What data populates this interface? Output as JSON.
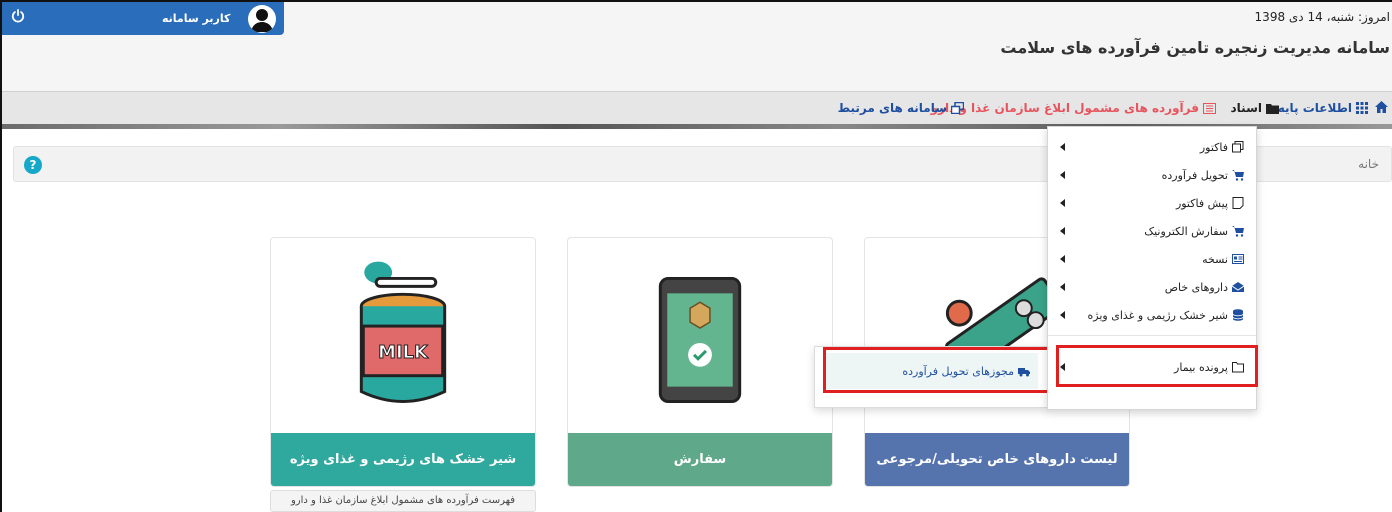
{
  "header": {
    "user_label": "کاربر سامانه",
    "date_text": "امروز: شنبه، 14 دی 1398",
    "app_title": "سامانه مدیریت زنجیره تامین فرآورده های سلامت"
  },
  "nav": {
    "base_info": "اطلاعات پایه",
    "documents": "اسناد",
    "fda_products": "فرآورده های مشمول ابلاغ سازمان غذا و دارو",
    "related_systems": "سامانه های مرتبط"
  },
  "breadcrumb": {
    "home": "خانه"
  },
  "dropdown": {
    "items": [
      "فاکتور",
      "تحویل فرآورده",
      "پیش فاکتور",
      "سفارش الکترونیک",
      "نسخه",
      "داروهای خاص",
      "شیر خشک رژیمی و غذای ویژه",
      "پرونده بیمار"
    ]
  },
  "submenu": {
    "item": "مجوزهای تحویل فرآورده"
  },
  "cards": {
    "milk": "شیر خشک های رژیمی و غذای ویژه",
    "order": "سفارش",
    "special_drugs": "لیست داروهای خاص تحویلی/مرجوعی",
    "milk_image_text": "MILK"
  },
  "under_link": "فهرست فرآورده های مشمول ابلاغ سازمان غذا و دارو",
  "colors": {
    "header_blue": "#2a6ebb",
    "card_teal": "#2fa89e",
    "card_green": "#5fa98a",
    "card_blue": "#5573ad",
    "highlight_red": "#e02020"
  }
}
